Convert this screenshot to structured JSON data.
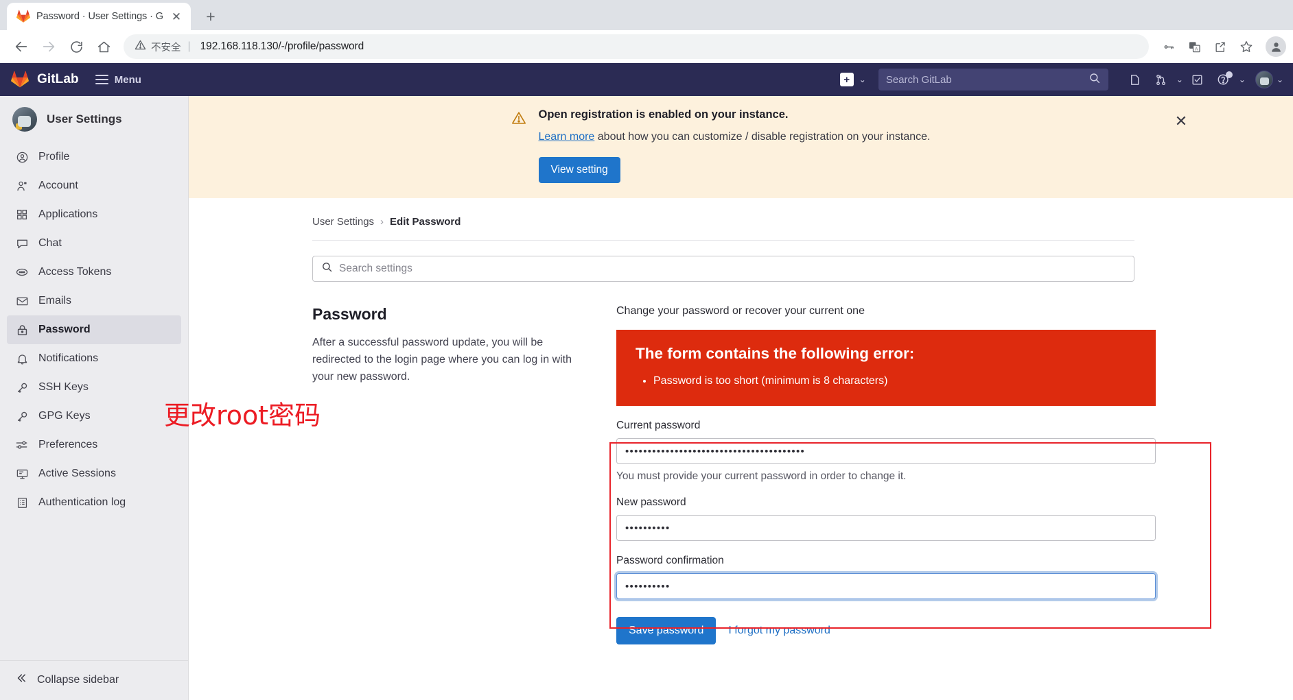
{
  "browser": {
    "tab": {
      "title": "Password · User Settings · GitL",
      "favicon": "gitlab-favicon",
      "close_icon": "close-icon"
    },
    "new_tab_label": "+",
    "nav": {
      "back_icon": "back-arrow-icon",
      "forward_icon": "forward-arrow-icon",
      "reload_icon": "reload-icon",
      "home_icon": "home-icon"
    },
    "omnibox": {
      "security_icon": "warning-triangle-icon",
      "security_label": "不安全",
      "separator": "|",
      "url": "192.168.118.130/-/profile/password"
    },
    "toolbar_icons": [
      "key-icon",
      "translate-icon",
      "share-icon",
      "bookmark-star-icon",
      "profile-avatar-icon"
    ]
  },
  "gitlab_nav": {
    "brand": "GitLab",
    "logo_icon": "gitlab-tanuki-logo",
    "menu_label": "Menu",
    "menu_icon": "hamburger-icon",
    "new_button": {
      "icon": "plus-icon",
      "caret": "chevron-down-icon"
    },
    "search": {
      "placeholder": "Search GitLab",
      "value": "",
      "icon": "search-icon"
    },
    "icons": [
      {
        "name": "issues-icon",
        "caret": false
      },
      {
        "name": "merge-requests-icon",
        "caret": true
      },
      {
        "name": "todos-icon",
        "caret": false
      },
      {
        "name": "help-icon",
        "caret": true,
        "badge": true
      },
      {
        "name": "user-avatar",
        "caret": true
      }
    ]
  },
  "sidebar": {
    "title": "User Settings",
    "avatar": "user-avatar",
    "items": [
      {
        "label": "Profile",
        "icon": "profile-icon",
        "active": false
      },
      {
        "label": "Account",
        "icon": "account-icon",
        "active": false
      },
      {
        "label": "Applications",
        "icon": "applications-grid-icon",
        "active": false
      },
      {
        "label": "Chat",
        "icon": "chat-bubble-icon",
        "active": false
      },
      {
        "label": "Access Tokens",
        "icon": "access-token-icon",
        "active": false
      },
      {
        "label": "Emails",
        "icon": "envelope-icon",
        "active": false
      },
      {
        "label": "Password",
        "icon": "lock-icon",
        "active": true
      },
      {
        "label": "Notifications",
        "icon": "bell-icon",
        "active": false
      },
      {
        "label": "SSH Keys",
        "icon": "key-icon",
        "active": false
      },
      {
        "label": "GPG Keys",
        "icon": "key-icon",
        "active": false
      },
      {
        "label": "Preferences",
        "icon": "sliders-icon",
        "active": false
      },
      {
        "label": "Active Sessions",
        "icon": "monitor-icon",
        "active": false
      },
      {
        "label": "Authentication log",
        "icon": "log-list-icon",
        "active": false
      }
    ],
    "collapse": {
      "label": "Collapse sidebar",
      "icon": "chevron-double-left-icon"
    }
  },
  "alert": {
    "icon": "warning-triangle-icon",
    "title": "Open registration is enabled on your instance.",
    "description_link": "Learn more",
    "description_rest": " about how you can customize / disable registration on your instance.",
    "button_label": "View setting",
    "close_icon": "close-icon"
  },
  "breadcrumb": {
    "root": "User Settings",
    "separator": "›",
    "current": "Edit Password"
  },
  "settings_search": {
    "placeholder": "Search settings",
    "value": "",
    "icon": "search-icon"
  },
  "section": {
    "heading": "Password",
    "description": "After a successful password update, you will be redirected to the login page where you can log in with your new password."
  },
  "form": {
    "intro": "Change your password or recover your current one",
    "error": {
      "heading": "The form contains the following error:",
      "items": [
        "Password is too short (minimum is 8 characters)"
      ]
    },
    "fields": [
      {
        "label": "Current password",
        "value": "••••••••••••••••••••••••••••••••••••••••",
        "hint": "You must provide your current password in order to change it.",
        "focused": false
      },
      {
        "label": "New password",
        "value": "••••••••••",
        "hint": "",
        "focused": false
      },
      {
        "label": "Password confirmation",
        "value": "••••••••••",
        "hint": "",
        "focused": true
      }
    ],
    "save_label": "Save password",
    "forgot_label": "I forgot my password"
  },
  "annotation": {
    "text": "更改root密码",
    "color": "#ec1c24"
  },
  "colors": {
    "gitlab_navy": "#2b2b54",
    "primary_blue": "#1f75cb",
    "error_red": "#dd2b0e",
    "warning_bg": "#fdf1dd",
    "sidebar_bg": "#ececef",
    "annotation_red": "#ec1c24"
  }
}
